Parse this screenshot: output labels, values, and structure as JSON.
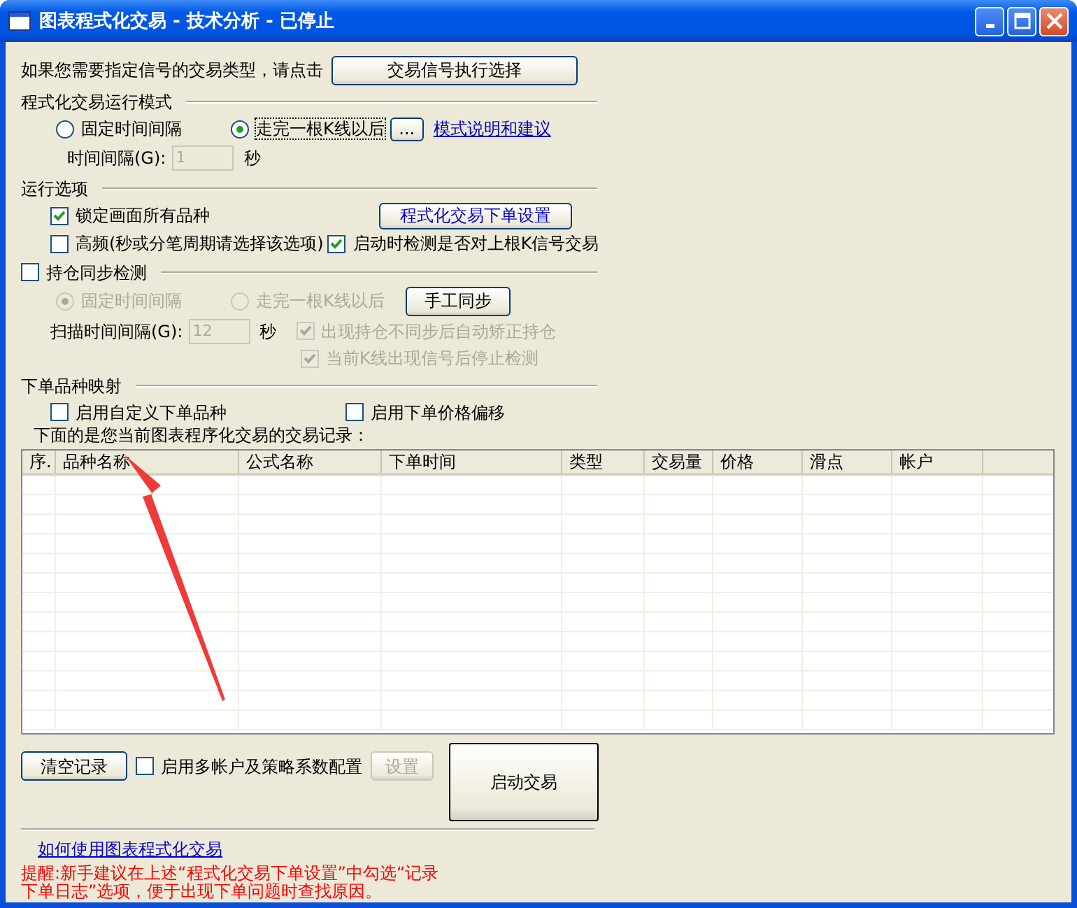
{
  "window": {
    "title": "图表程式化交易 - 技术分析 - 已停止"
  },
  "signal_prompt": {
    "text": "如果您需要指定信号的交易类型，请点击",
    "button": "交易信号执行选择"
  },
  "run_mode": {
    "title": "程式化交易运行模式",
    "options": [
      {
        "label": "固定时间间隔",
        "selected": false
      },
      {
        "label": "走完一根K线以后",
        "selected": true
      }
    ],
    "more_button": "...",
    "help_link": "模式说明和建议",
    "interval": {
      "label": "时间间隔(G):",
      "value": "1",
      "unit": "秒",
      "disabled": true
    }
  },
  "run_options": {
    "title": "运行选项",
    "order_settings_button": "程式化交易下单设置",
    "checkboxes": [
      {
        "label": "锁定画面所有品种",
        "checked": true
      },
      {
        "label": "高频(秒或分笔周期请选择该选项)",
        "checked": false
      },
      {
        "label": "启动时检测是否对上根K信号交易",
        "checked": true
      }
    ]
  },
  "position_sync": {
    "label": "持仓同步检测",
    "checked": false,
    "disabled": true,
    "options": [
      {
        "label": "固定时间间隔",
        "selected": true
      },
      {
        "label": "走完一根K线以后",
        "selected": false
      }
    ],
    "manual_sync_button": "手工同步",
    "interval": {
      "label": "扫描时间间隔(G):",
      "value": "12",
      "unit": "秒"
    },
    "checkboxes": [
      {
        "label": "出现持仓不同步后自动矫正持仓",
        "checked": true
      },
      {
        "label": "当前K线出现信号后停止检测",
        "checked": true
      }
    ]
  },
  "symbol_mapping": {
    "title": "下单品种映射",
    "checkboxes": [
      {
        "label": "启用自定义下单品种",
        "checked": false
      },
      {
        "label": "启用下单价格偏移",
        "checked": false
      }
    ]
  },
  "records": {
    "caption": "下面的是您当前图表程序化交易的交易记录：",
    "columns": [
      "序.",
      "品种名称",
      "公式名称",
      "下单时间",
      "类型",
      "交易量",
      "价格",
      "滑点",
      "帐户"
    ]
  },
  "bottom": {
    "clear_button": "清空记录",
    "multi_account": {
      "label": "启用多帐户及策略系数配置",
      "checked": false
    },
    "settings_button": {
      "label": "设置",
      "disabled": true
    },
    "start_button": "启动交易"
  },
  "help_link": "如何使用图表程式化交易",
  "reminder": [
    "提醒:新手建议在上述“程式化交易下单设置”中勾选“记录",
    "下单日志”选项，便于出现下单问题时查找原因。"
  ]
}
